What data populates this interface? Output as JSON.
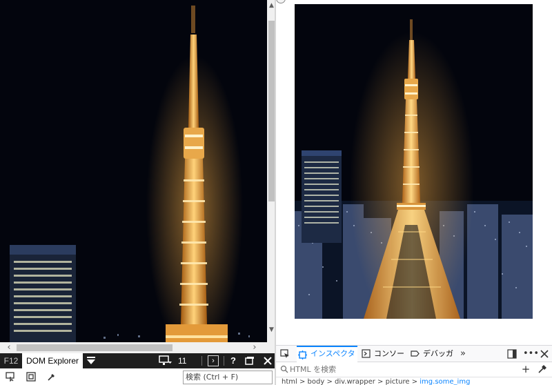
{
  "ie_devtools": {
    "f12_label": "F12",
    "active_tab": "DOM Explorer",
    "emulation_value": "11",
    "help_label": "?",
    "search_placeholder": "検索 (Ctrl + F)"
  },
  "firefox_devtools": {
    "tabs": [
      {
        "label": "インスペクター",
        "icon": "inspector-icon",
        "selected": true
      },
      {
        "label": "コンソール",
        "icon": "console-icon",
        "selected": false
      },
      {
        "label": "デバッガー",
        "icon": "debugger-icon",
        "selected": false
      }
    ],
    "search_placeholder": "HTML を検索",
    "breadcrumbs": [
      "html",
      "body",
      "div.wrapper",
      "picture",
      "img.some_img"
    ]
  },
  "colors": {
    "ie_bar_bg": "#1e1e1e",
    "ff_accent": "#0a84ff",
    "tower_glow": "#f0a030"
  }
}
